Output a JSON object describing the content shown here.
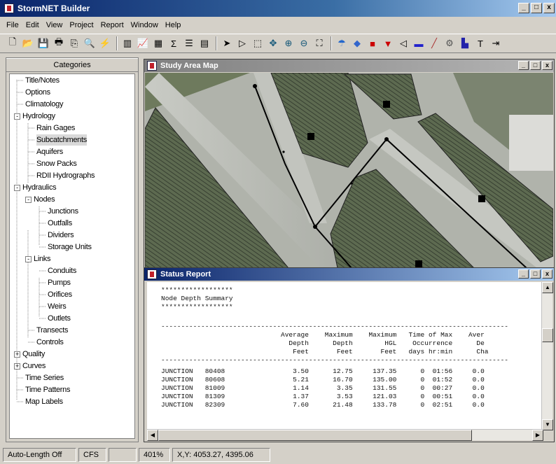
{
  "app": {
    "title": "StormNET Builder"
  },
  "menu": [
    "File",
    "Edit",
    "View",
    "Project",
    "Report",
    "Window",
    "Help"
  ],
  "window_buttons": [
    "_",
    "□",
    "x"
  ],
  "toolbar_icons": [
    "new-icon",
    "open-icon",
    "save-icon",
    "print-icon",
    "copy-icon",
    "find-icon",
    "run-icon",
    "sep",
    "panel-icon",
    "graph-icon",
    "table-icon",
    "sum-icon",
    "props-icon",
    "layers-icon",
    "sep",
    "pointer-icon",
    "select-vertex-icon",
    "select-region-icon",
    "pan-icon",
    "zoom-in-icon",
    "zoom-out-icon",
    "full-extent-icon",
    "sep",
    "raingage-icon",
    "subcatch-icon",
    "junction-icon",
    "outfall-icon",
    "divider-icon",
    "storage-icon",
    "conduit-icon",
    "pump-icon",
    "weir-icon",
    "label-icon",
    "outlet-icon"
  ],
  "browser": {
    "header": "Categories",
    "items": [
      {
        "label": "Title/Notes",
        "level": 0
      },
      {
        "label": "Options",
        "level": 0
      },
      {
        "label": "Climatology",
        "level": 0
      },
      {
        "label": "Hydrology",
        "level": 0,
        "toggle": "-"
      },
      {
        "label": "Rain Gages",
        "level": 1
      },
      {
        "label": "Subcatchments",
        "level": 1,
        "selected": true
      },
      {
        "label": "Aquifers",
        "level": 1
      },
      {
        "label": "Snow Packs",
        "level": 1
      },
      {
        "label": "RDII Hydrographs",
        "level": 1
      },
      {
        "label": "Hydraulics",
        "level": 0,
        "toggle": "-"
      },
      {
        "label": "Nodes",
        "level": 1,
        "toggle": "-"
      },
      {
        "label": "Junctions",
        "level": 2
      },
      {
        "label": "Outfalls",
        "level": 2
      },
      {
        "label": "Dividers",
        "level": 2
      },
      {
        "label": "Storage Units",
        "level": 2
      },
      {
        "label": "Links",
        "level": 1,
        "toggle": "-"
      },
      {
        "label": "Conduits",
        "level": 2
      },
      {
        "label": "Pumps",
        "level": 2
      },
      {
        "label": "Orifices",
        "level": 2
      },
      {
        "label": "Weirs",
        "level": 2
      },
      {
        "label": "Outlets",
        "level": 2
      },
      {
        "label": "Transects",
        "level": 1
      },
      {
        "label": "Controls",
        "level": 1
      },
      {
        "label": "Quality",
        "level": 0,
        "toggle": "+"
      },
      {
        "label": "Curves",
        "level": 0,
        "toggle": "+"
      },
      {
        "label": "Time Series",
        "level": 0
      },
      {
        "label": "Time Patterns",
        "level": 0
      },
      {
        "label": "Map Labels",
        "level": 0
      }
    ]
  },
  "map_window": {
    "title": "Study Area Map"
  },
  "report_window": {
    "title": "Status Report",
    "lines": [
      "******************",
      "Node Depth Summary",
      "******************",
      "",
      "---------------------------------------------------------------------------------------",
      "                              Average    Maximum    Maximum   Time of Max    Aver",
      "                                Depth      Depth        HGL    Occurrence      De",
      "                                 Feet       Feet       Feet   days hr:min      Cha",
      "---------------------------------------------------------------------------------------",
      "JUNCTION   80408                 3.50      12.75     137.35      0  01:56     0.0",
      "JUNCTION   80608                 5.21      16.70     135.00      0  01:52     0.0",
      "JUNCTION   81009                 1.14       3.35     131.55      0  00:27     0.0",
      "JUNCTION   81309                 1.37       3.53     121.03      0  00:51     0.0",
      "JUNCTION   82309                 7.60      21.48     133.78      0  02:51     0.0"
    ]
  },
  "statusbar": {
    "auto_length": "Auto-Length Off",
    "flow_units": "CFS",
    "zoom": "401%",
    "coords": "X,Y: 4053.27, 4395.06"
  }
}
